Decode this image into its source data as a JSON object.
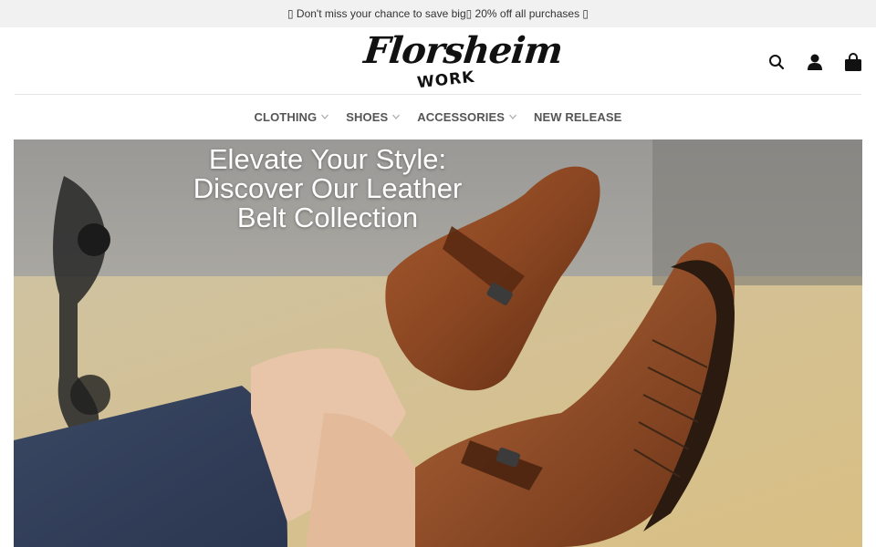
{
  "announcement": {
    "text": "\u0000 Don't miss your chance to save big\u0000 20% off all purchases \u0000",
    "display": "▯ Don't miss your chance to save big▯ 20% off all purchases ▯"
  },
  "logo": {
    "script": "Florsheim",
    "sub": "WORK"
  },
  "header_icons": [
    "search-icon",
    "account-icon",
    "cart-icon"
  ],
  "nav": {
    "items": [
      {
        "label": "CLOTHING",
        "has_dropdown": true
      },
      {
        "label": "SHOES",
        "has_dropdown": true
      },
      {
        "label": "ACCESSORIES",
        "has_dropdown": true
      },
      {
        "label": "NEW RELEASE",
        "has_dropdown": false
      }
    ]
  },
  "hero": {
    "title": "Elevate Your Style: Discover Our Leather Belt Collection"
  },
  "colors": {
    "topbar_bg": "#f1f1f1",
    "nav_text": "#555555",
    "leather": "#8b4a26"
  }
}
